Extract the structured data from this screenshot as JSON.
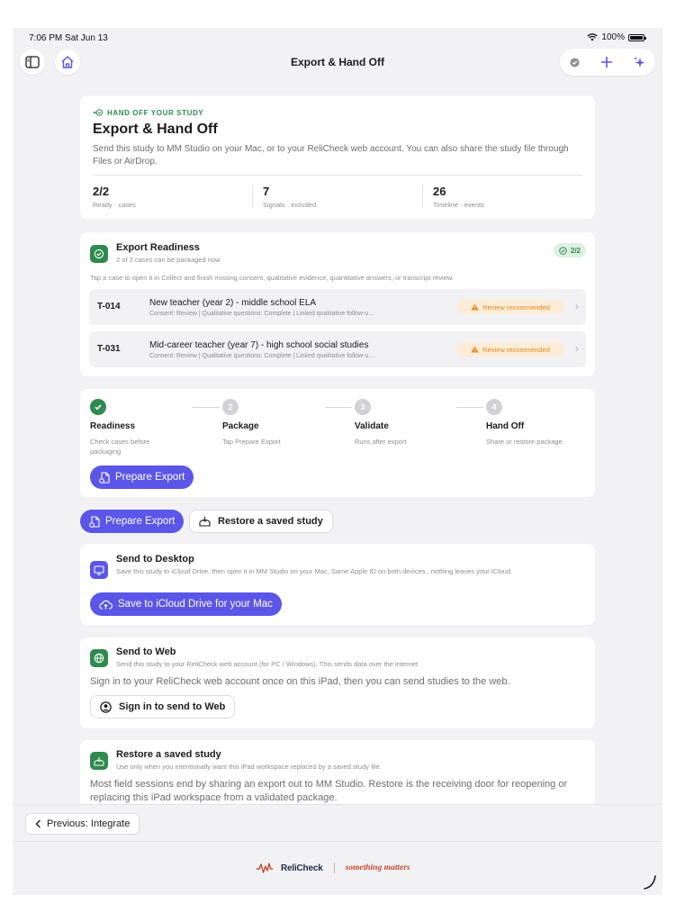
{
  "status_bar": {
    "time": "7:06 PM  Sat Jun 13",
    "battery": "100%"
  },
  "nav": {
    "title": "Export & Hand Off"
  },
  "overview": {
    "eyebrow": "HAND OFF YOUR STUDY",
    "title": "Export & Hand Off",
    "description": "Send this study to MM Studio on your Mac, or to your ReliCheck web account. You can also share the study file through Files or AirDrop.",
    "stats": [
      {
        "value": "2/2",
        "label": "Ready · cases"
      },
      {
        "value": "7",
        "label": "Signals · included"
      },
      {
        "value": "26",
        "label": "Timeline · events"
      }
    ]
  },
  "readiness": {
    "title": "Export Readiness",
    "subtitle": "2 of 2 cases can be packaged now",
    "badge": "2/2",
    "hint": "Tap a case to open it in Collect and finish missing consent, qualitative evidence, quantitative answers, or transcript review.",
    "cases": [
      {
        "id": "T-014",
        "title": "New teacher (year 2) - middle school ELA",
        "detail": "Consent: Review | Qualitative questions: Complete | Linked qualitative follow-u...",
        "status": "Review recommended"
      },
      {
        "id": "T-031",
        "title": "Mid-career teacher (year 7) - high school social studies",
        "detail": "Consent: Review | Qualitative questions: Complete | Linked qualitative follow-u...",
        "status": "Review recommended"
      }
    ]
  },
  "steps": {
    "items": [
      {
        "number": "1",
        "title": "Readiness",
        "sub": "Check cases before packaging",
        "state": "done"
      },
      {
        "number": "2",
        "title": "Package",
        "sub": "Tap Prepare Export",
        "state": "pending"
      },
      {
        "number": "3",
        "title": "Validate",
        "sub": "Runs after export",
        "state": "pending"
      },
      {
        "number": "4",
        "title": "Hand Off",
        "sub": "Share or restore package",
        "state": "pending"
      }
    ],
    "button": "Prepare Export"
  },
  "actions": {
    "prepare": "Prepare Export",
    "restore": "Restore a saved study"
  },
  "desktop": {
    "title": "Send to Desktop",
    "subtitle": "Save this study to iCloud Drive, then open it in MM Studio on your Mac. Same Apple ID on both devices , nothing leaves your iCloud.",
    "button": "Save to iCloud Drive for your Mac"
  },
  "web": {
    "title": "Send to Web",
    "subtitle": "Send this study to your ReliCheck web account (for PC / Windows). This sends data over the internet.",
    "body": "Sign in to your ReliCheck web account once on this iPad, then you can send studies to the web.",
    "button": "Sign in to send to Web"
  },
  "restore": {
    "title": "Restore a saved study",
    "subtitle": "Use only when you intentionally want this iPad workspace replaced by a saved study file.",
    "body": "Most field sessions end by sharing an export out to MM Studio. Restore is the receiving door for reopening or replacing this iPad workspace from a validated package."
  },
  "bottom": {
    "previous": "Previous: Integrate"
  },
  "footer": {
    "brand": "ReliCheck",
    "tagline": "something matters"
  },
  "colors": {
    "accent": "#5b55e8",
    "success": "#2e8a4e",
    "warning": "#e8881a",
    "brand_red": "#c0492f"
  }
}
